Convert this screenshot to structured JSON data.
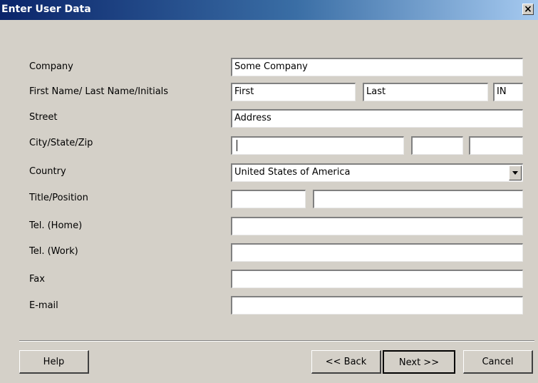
{
  "window": {
    "title": "Enter User Data",
    "close_glyph": "×"
  },
  "labels": {
    "company": "Company",
    "name": "First Name/ Last Name/Initials",
    "street": "Street",
    "city": "City/State/Zip",
    "country": "Country",
    "title": "Title/Position",
    "tel_home": "Tel. (Home)",
    "tel_work": "Tel. (Work)",
    "fax": "Fax",
    "email": "E-mail"
  },
  "fields": {
    "company": "Some Company",
    "first_name": "First",
    "last_name": "Last",
    "initials": "IN",
    "street": "Address",
    "city": "",
    "state": "",
    "zip": "",
    "country": "United States of America",
    "title": "",
    "position": "",
    "tel_home": "",
    "tel_work": "",
    "fax": "",
    "email": ""
  },
  "buttons": {
    "help": "Help",
    "back": "<< Back",
    "next": "Next >>",
    "cancel": "Cancel"
  }
}
